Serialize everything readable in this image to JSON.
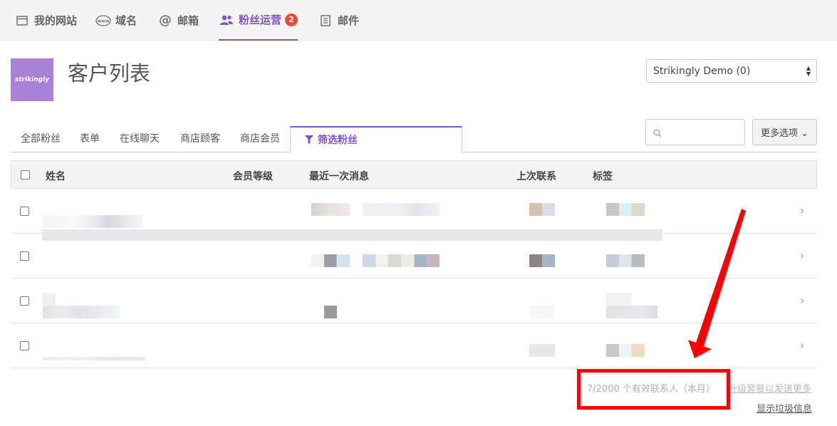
{
  "topnav": {
    "items": [
      {
        "label": "我的网站",
        "icon": "browser-window-icon"
      },
      {
        "label": "域名",
        "icon": "www-icon"
      },
      {
        "label": "邮箱",
        "icon": "at-sign-icon"
      },
      {
        "label": "粉丝运营",
        "icon": "users-icon",
        "badge": "2",
        "active": true
      },
      {
        "label": "邮件",
        "icon": "document-icon"
      }
    ]
  },
  "header": {
    "logo_text": "strikingly",
    "title": "客户列表",
    "site_select_value": "Strikingly Demo (0)"
  },
  "tabs": [
    {
      "label": "全部粉丝"
    },
    {
      "label": "表单"
    },
    {
      "label": "在线聊天"
    },
    {
      "label": "商店顾客"
    },
    {
      "label": "商店会员"
    },
    {
      "label": "筛选粉丝",
      "active": true,
      "icon": "filter-icon"
    }
  ],
  "toolbar": {
    "search_placeholder": "",
    "more_options_label": "更多选项 ⌄"
  },
  "table": {
    "headers": {
      "name": "姓名",
      "member_level": "会员等级",
      "last_message": "最近一次消息",
      "last_contact": "上次联系",
      "tags": "标签"
    },
    "row_count": 4
  },
  "footer": {
    "contacts_count": "7/2000 个有效联系人（本月）",
    "upgrade_link": "升级套餐以发送更多",
    "show_trash_link": "显示垃圾信息"
  },
  "colors": {
    "accent": "#7e57c2",
    "badge": "#e74c3c",
    "annotation": "#ff0000"
  }
}
